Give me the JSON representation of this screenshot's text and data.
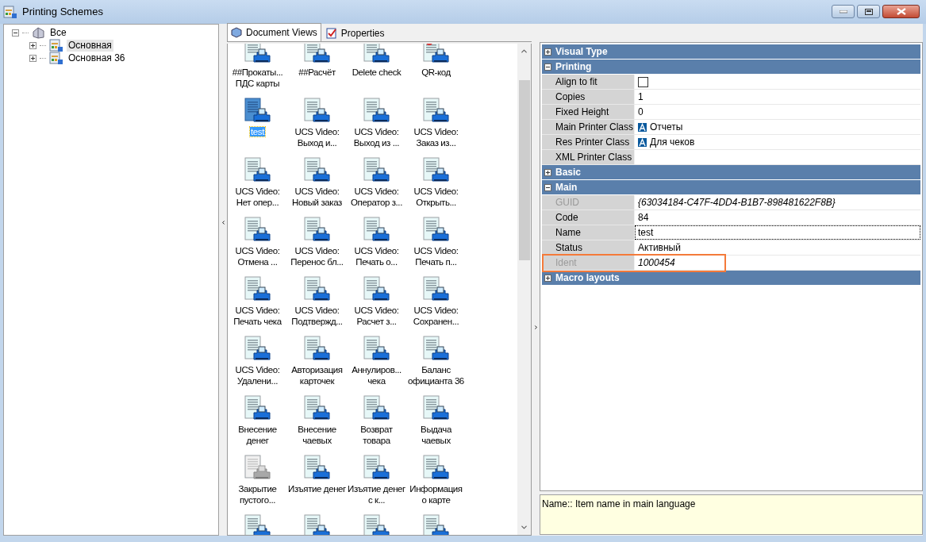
{
  "window": {
    "title": "Printing Schemes"
  },
  "tree": [
    {
      "label": "Все",
      "expanded": true,
      "selected": false,
      "children": [
        {
          "label": "Основная",
          "expanded": false,
          "selected": true
        },
        {
          "label": "Основная 36",
          "expanded": false,
          "selected": false
        }
      ]
    }
  ],
  "tabs": [
    {
      "label": "Document Views",
      "selected": true
    },
    {
      "label": "Properties",
      "selected": false
    }
  ],
  "views": [
    {
      "kind": "view",
      "label": "##Прокаты... ПДС карты",
      "selected": false,
      "disabled": false
    },
    {
      "kind": "view",
      "label": "##Расчёт",
      "selected": false,
      "disabled": false
    },
    {
      "kind": "view",
      "label": "Delete check",
      "selected": false,
      "disabled": false
    },
    {
      "kind": "marked",
      "label": "QR-код",
      "selected": false,
      "disabled": false
    },
    {
      "kind": "view",
      "label": "test",
      "selected": true,
      "disabled": false
    },
    {
      "kind": "view",
      "label": "UCS Video: Выход и...",
      "selected": false,
      "disabled": false
    },
    {
      "kind": "view",
      "label": "UCS Video: Выход из ...",
      "selected": false,
      "disabled": false
    },
    {
      "kind": "view",
      "label": "UCS Video: Заказ из...",
      "selected": false,
      "disabled": false
    },
    {
      "kind": "view",
      "label": "UCS Video: Нет опер...",
      "selected": false,
      "disabled": false
    },
    {
      "kind": "view",
      "label": "UCS Video: Новый заказ",
      "selected": false,
      "disabled": false
    },
    {
      "kind": "view",
      "label": "UCS Video: Оператор з...",
      "selected": false,
      "disabled": false
    },
    {
      "kind": "view",
      "label": "UCS Video: Открыть...",
      "selected": false,
      "disabled": false
    },
    {
      "kind": "view",
      "label": "UCS Video: Отмена ...",
      "selected": false,
      "disabled": false
    },
    {
      "kind": "view",
      "label": "UCS Video: Перенос бл...",
      "selected": false,
      "disabled": false
    },
    {
      "kind": "view",
      "label": "UCS Video: Печать о...",
      "selected": false,
      "disabled": false
    },
    {
      "kind": "view",
      "label": "UCS Video: Печать п...",
      "selected": false,
      "disabled": false
    },
    {
      "kind": "view",
      "label": "UCS Video: Печать чека",
      "selected": false,
      "disabled": false
    },
    {
      "kind": "view",
      "label": "UCS Video: Подтвержд...",
      "selected": false,
      "disabled": false
    },
    {
      "kind": "view",
      "label": "UCS Video: Расчет з...",
      "selected": false,
      "disabled": false
    },
    {
      "kind": "view",
      "label": "UCS Video: Сохранен...",
      "selected": false,
      "disabled": false
    },
    {
      "kind": "view",
      "label": "UCS Video: Удалени...",
      "selected": false,
      "disabled": false
    },
    {
      "kind": "view",
      "label": "Авторизация карточек",
      "selected": false,
      "disabled": false
    },
    {
      "kind": "view",
      "label": "Аннулиров... чека",
      "selected": false,
      "disabled": false
    },
    {
      "kind": "view",
      "label": "Баланс официанта 36",
      "selected": false,
      "disabled": false
    },
    {
      "kind": "view",
      "label": "Внесение денег",
      "selected": false,
      "disabled": false
    },
    {
      "kind": "view",
      "label": "Внесение чаевых",
      "selected": false,
      "disabled": false
    },
    {
      "kind": "view",
      "label": "Возврат товара",
      "selected": false,
      "disabled": false
    },
    {
      "kind": "view",
      "label": "Выдача чаевых",
      "selected": false,
      "disabled": false
    },
    {
      "kind": "view",
      "label": "Закрытие пустого...",
      "selected": false,
      "disabled": true
    },
    {
      "kind": "view",
      "label": "Изъятие денег",
      "selected": false,
      "disabled": false
    },
    {
      "kind": "view",
      "label": "Изъятие денег с к...",
      "selected": false,
      "disabled": false
    },
    {
      "kind": "view",
      "label": "Информация о карте",
      "selected": false,
      "disabled": false
    },
    {
      "kind": "icon_only",
      "selected": false,
      "disabled": false
    },
    {
      "kind": "icon_only",
      "selected": false,
      "disabled": false
    },
    {
      "kind": "icon_only",
      "selected": false,
      "disabled": false
    },
    {
      "kind": "icon_only",
      "selected": false,
      "disabled": false
    }
  ],
  "properties": [
    {
      "section": "Visual Type",
      "expanded": false
    },
    {
      "section": "Printing",
      "expanded": true,
      "rows": [
        {
          "label": "Align to fit",
          "kind": "checkbox",
          "checked": false,
          "disabled": false,
          "selected": false,
          "highlighted": false
        },
        {
          "label": "Copies",
          "kind": "text",
          "value": "1",
          "disabled": false,
          "selected": false,
          "highlighted": false
        },
        {
          "label": "Fixed Height",
          "kind": "text",
          "value": "0",
          "disabled": false,
          "selected": false,
          "highlighted": false
        },
        {
          "label": "Main Printer Class",
          "kind": "class",
          "value": "Отчеты",
          "disabled": false,
          "selected": false,
          "highlighted": false
        },
        {
          "label": "Res Printer Class",
          "kind": "class",
          "value": "Для чеков",
          "disabled": false,
          "selected": false,
          "highlighted": false
        },
        {
          "label": "XML Printer Class",
          "kind": "empty",
          "disabled": false,
          "selected": false,
          "highlighted": false
        }
      ]
    },
    {
      "section": "Basic",
      "expanded": false
    },
    {
      "section": "Main",
      "expanded": true,
      "rows": [
        {
          "label": "GUID",
          "kind": "text",
          "value": "{63034184-C47F-4DD4-B1B7-898481622F8B}",
          "disabled": true,
          "selected": false,
          "highlighted": false
        },
        {
          "label": "Code",
          "kind": "text",
          "value": "84",
          "disabled": false,
          "selected": false,
          "highlighted": false
        },
        {
          "label": "Name",
          "kind": "text",
          "value": "test",
          "disabled": false,
          "selected": true,
          "highlighted": false
        },
        {
          "label": "Status",
          "kind": "text",
          "value": "Активный",
          "disabled": false,
          "selected": false,
          "highlighted": false
        },
        {
          "label": "Ident",
          "kind": "text",
          "value": "1000454",
          "disabled": true,
          "selected": false,
          "highlighted": true
        }
      ]
    },
    {
      "section": "Macro layouts",
      "expanded": false
    }
  ],
  "description": "Name:: Item name in main language"
}
